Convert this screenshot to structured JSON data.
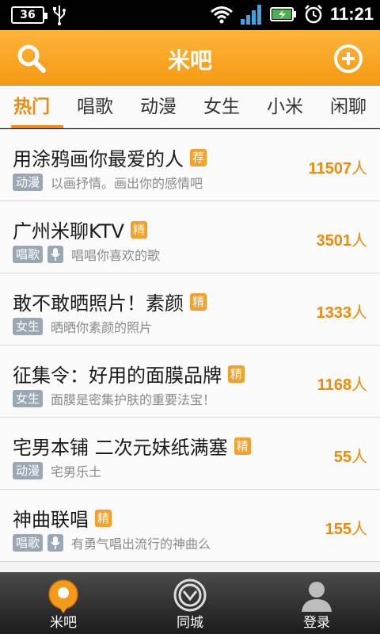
{
  "status_bar": {
    "battery_left": "36",
    "time": "11:21"
  },
  "header": {
    "title": "米吧",
    "search_icon": "search-icon",
    "add_icon": "add-icon"
  },
  "tabs": [
    {
      "label": "热门",
      "active": true
    },
    {
      "label": "唱歌",
      "active": false
    },
    {
      "label": "动漫",
      "active": false
    },
    {
      "label": "女生",
      "active": false
    },
    {
      "label": "小米",
      "active": false
    },
    {
      "label": "闲聊",
      "active": false
    }
  ],
  "items": [
    {
      "title": "用涂鸦画你最爱的人",
      "badge": "荐",
      "category": "动漫",
      "mic": false,
      "desc": "以画抒情。画出你的感情吧",
      "count": "11507",
      "unit": "人"
    },
    {
      "title": "广州米聊KTV",
      "badge": "精",
      "category": "唱歌",
      "mic": true,
      "desc": "唱唱你喜欢的歌",
      "count": "3501",
      "unit": "人"
    },
    {
      "title": "敢不敢晒照片！素颜",
      "badge": "精",
      "category": "女生",
      "mic": false,
      "desc": "晒晒你素颜的照片",
      "count": "1333",
      "unit": "人"
    },
    {
      "title": "征集令：好用的面膜品牌",
      "badge": "精",
      "category": "女生",
      "mic": false,
      "desc": "面膜是密集护肤的重要法宝！",
      "count": "1168",
      "unit": "人"
    },
    {
      "title": "宅男本铺 二次元妹纸满塞",
      "badge": "精",
      "category": "动漫",
      "mic": false,
      "desc": "宅男乐土",
      "count": "55",
      "unit": "人"
    },
    {
      "title": "神曲联唱",
      "badge": "精",
      "category": "唱歌",
      "mic": true,
      "desc": "有勇气唱出流行的神曲么",
      "count": "155",
      "unit": "人"
    }
  ],
  "bottom_nav": [
    {
      "label": "米吧",
      "icon": "location-pin-icon",
      "active": true
    },
    {
      "label": "同城",
      "icon": "radar-icon",
      "active": false
    },
    {
      "label": "登录",
      "icon": "user-icon",
      "active": false
    }
  ],
  "colors": {
    "accent": "#f08a0a",
    "header_top": "#ffb43a",
    "header_bottom": "#f49a14",
    "tag": "#9aa8b5"
  }
}
